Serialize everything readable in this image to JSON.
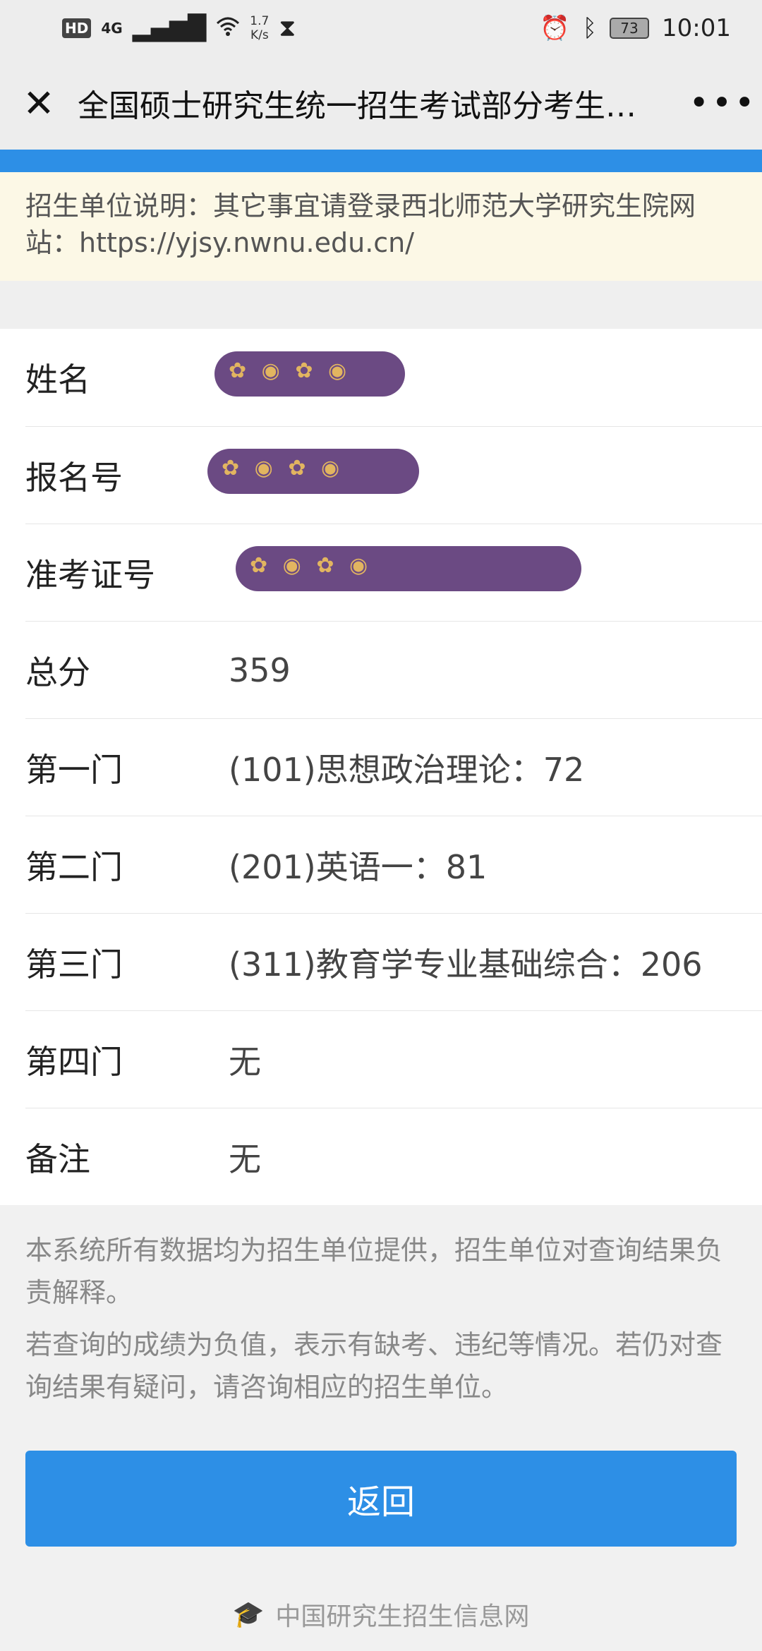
{
  "status_bar": {
    "hd": "HD",
    "net": "4G",
    "speed_top": "1.7",
    "speed_bottom": "K/s",
    "battery": "73",
    "time": "10:01",
    "icons": [
      "signal-icon",
      "wifi-icon",
      "hourglass-icon",
      "alarm-icon",
      "bluetooth-icon",
      "battery-icon"
    ]
  },
  "navbar": {
    "title": "全国硕士研究生统一招生考试部分考生…",
    "close_icon": "close-icon",
    "more_icon": "more-icon"
  },
  "notice": {
    "text": "招生单位说明：其它事宜请登录西北师范大学研究生院网站：https://yjsy.nwnu.edu.cn/"
  },
  "results": [
    {
      "label": "姓名",
      "value": ""
    },
    {
      "label": "报名号",
      "value": ""
    },
    {
      "label": "准考证号",
      "value": ""
    },
    {
      "label": "总分",
      "value": "359"
    },
    {
      "label": "第一门",
      "value": "(101)思想政治理论：72"
    },
    {
      "label": "第二门",
      "value": "(201)英语一：81"
    },
    {
      "label": "第三门",
      "value": "(311)教育学专业基础综合：206"
    },
    {
      "label": "第四门",
      "value": "无"
    },
    {
      "label": "备注",
      "value": "无"
    }
  ],
  "footer": {
    "note1": "本系统所有数据均为招生单位提供，招生单位对查询结果负责解释。",
    "note2": "若查询的成绩为负值，表示有缺考、违纪等情况。若仍对查询结果有疑问，请咨询相应的招生单位。",
    "back_button": "返回",
    "brand": "中国研究生招生信息网"
  },
  "colors": {
    "accent": "#2d8fe6",
    "notice_bg": "#fcf8e6",
    "redaction": "#6b4a83"
  }
}
